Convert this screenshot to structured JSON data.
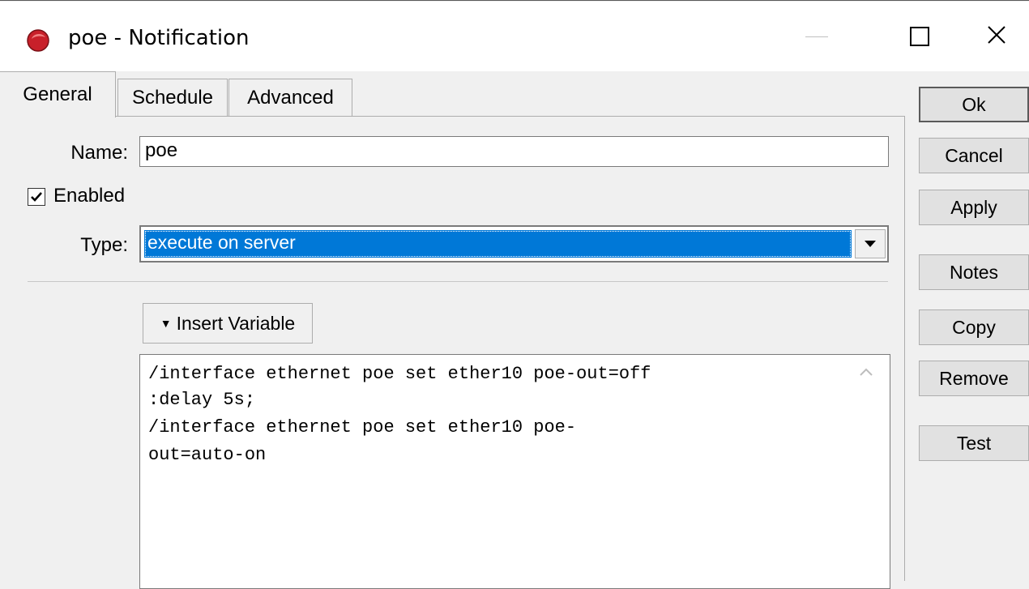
{
  "window": {
    "title": "poe - Notification"
  },
  "tabs": [
    {
      "label": "General",
      "active": true
    },
    {
      "label": "Schedule",
      "active": false
    },
    {
      "label": "Advanced",
      "active": false
    }
  ],
  "general": {
    "name_label": "Name:",
    "name_value": "poe",
    "enabled_label": "Enabled",
    "enabled_checked": true,
    "type_label": "Type:",
    "type_value": "execute on server",
    "insert_variable_label": "Insert Variable",
    "script_lines": [
      "/interface ethernet poe set ether10 poe-out=off",
      ":delay 5s;",
      "/interface ethernet poe set ether10 poe-",
      "out=auto-on"
    ]
  },
  "side_buttons": {
    "ok": "Ok",
    "cancel": "Cancel",
    "apply": "Apply",
    "notes": "Notes",
    "copy": "Copy",
    "remove": "Remove",
    "test": "Test"
  },
  "colors": {
    "selection": "#0078d7",
    "window_bg": "#f0f0f0"
  },
  "icons": {
    "app": "mikrotik-logo-icon",
    "minimize": "minimize-icon",
    "maximize": "maximize-icon",
    "close": "close-icon",
    "checkbox": "checkmark-icon",
    "dropdown": "chevron-down-icon",
    "scroll": "scroll-up-icon"
  }
}
